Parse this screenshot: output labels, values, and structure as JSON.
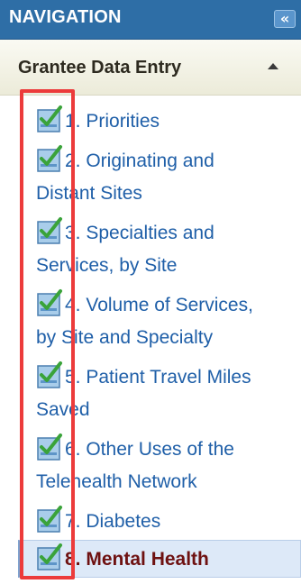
{
  "header": {
    "title": "NAVIGATION",
    "collapse_icon": "double-chevron-left-icon"
  },
  "section": {
    "title": "Grantee Data Entry",
    "toggle_icon": "caret-up-icon"
  },
  "items": [
    {
      "line1": "1. Priorities",
      "line2": "",
      "status_icon": "checked-box-icon"
    },
    {
      "line1": "2. Originating and",
      "line2": "Distant Sites",
      "status_icon": "checked-box-icon"
    },
    {
      "line1": "3. Specialties and",
      "line2": "Services, by Site",
      "status_icon": "checked-box-icon"
    },
    {
      "line1": "4. Volume of Services,",
      "line2": "by Site and Specialty",
      "status_icon": "checked-box-icon"
    },
    {
      "line1": "5. Patient Travel Miles",
      "line2": "Saved",
      "status_icon": "checked-box-icon"
    },
    {
      "line1": "6. Other Uses of the",
      "line2": "Telehealth Network",
      "status_icon": "checked-box-icon"
    },
    {
      "line1": "7. Diabetes",
      "line2": "",
      "status_icon": "checked-box-icon"
    },
    {
      "line1": "8. Mental Health",
      "line2": "",
      "status_icon": "checked-box-icon",
      "active": true
    }
  ],
  "colors": {
    "header_bg": "#2e6ea6",
    "link": "#1f5fa8",
    "active_text": "#6e1111",
    "highlight": "#ec3b3b",
    "check": "#3aa33a"
  }
}
